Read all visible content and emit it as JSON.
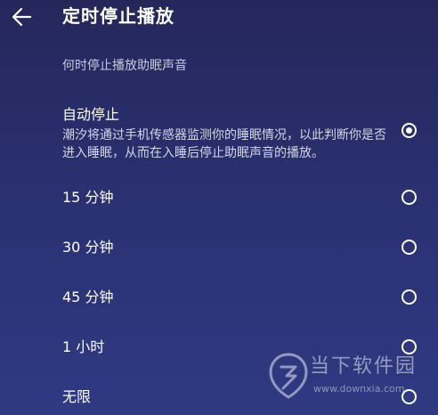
{
  "header": {
    "title": "定时停止播放",
    "back_icon": "arrow-left-icon"
  },
  "section": {
    "title": "何时停止播放助眠声音"
  },
  "options": [
    {
      "label": "自动停止",
      "description": "潮汐将通过手机传感器监测你的睡眠情况，以此判断你是否进入睡眠，从而在入睡后停止助眠声音的播放。",
      "selected": true
    },
    {
      "label": "15 分钟",
      "selected": false
    },
    {
      "label": "30 分钟",
      "selected": false
    },
    {
      "label": "45 分钟",
      "selected": false
    },
    {
      "label": "1 小时",
      "selected": false
    },
    {
      "label": "无限",
      "selected": false
    }
  ],
  "watermark": {
    "text": "当下软件园",
    "url": "www.downxia.com"
  },
  "colors": {
    "background_top": "#25275b",
    "background_bottom": "#2f3a83",
    "text": "#ffffff",
    "muted_text": "#c7c9dc"
  }
}
